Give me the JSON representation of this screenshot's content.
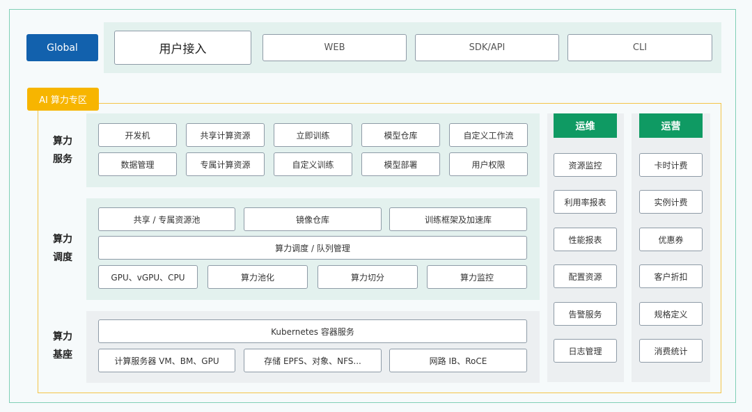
{
  "global": {
    "badge": "Global",
    "user_access": "用户接入",
    "web": "WEB",
    "sdk": "SDK/API",
    "cli": "CLI"
  },
  "ai_zone": {
    "badge": "AI 算力专区"
  },
  "service": {
    "label_1": "算力",
    "label_2": "服务",
    "row1": [
      "开发机",
      "共享计算资源",
      "立即训练",
      "模型仓库",
      "自定义工作流"
    ],
    "row2": [
      "数据管理",
      "专属计算资源",
      "自定义训练",
      "模型部署",
      "用户权限"
    ]
  },
  "schedule": {
    "label_1": "算力",
    "label_2": "调度",
    "pool": "共享 / 专属资源池",
    "mirror": "镜像仓库",
    "framework": "训练框架及加速库",
    "queue": "算力调度 / 队列管理",
    "row3": [
      "GPU、vGPU、CPU",
      "算力池化",
      "算力切分",
      "算力监控"
    ]
  },
  "base": {
    "label_1": "算力",
    "label_2": "基座",
    "k8s": "Kubernetes 容器服务",
    "compute": "计算服务器 VM、BM、GPU",
    "storage": "存储 EPFS、对象、NFS...",
    "network": "网路 IB、RoCE"
  },
  "ops": {
    "title": "运维",
    "items": [
      "资源监控",
      "利用率报表",
      "性能报表",
      "配置资源",
      "告警服务",
      "日志管理"
    ]
  },
  "operation": {
    "title": "运营",
    "items": [
      "卡时计费",
      "实例计费",
      "优惠券",
      "客户折扣",
      "规格定义",
      "消费统计"
    ]
  },
  "colors": {
    "global_blue": "#1261ad",
    "ai_yellow": "#f7b500",
    "ops_green": "#0f9a63",
    "panel_mint": "#e3f1ee"
  }
}
